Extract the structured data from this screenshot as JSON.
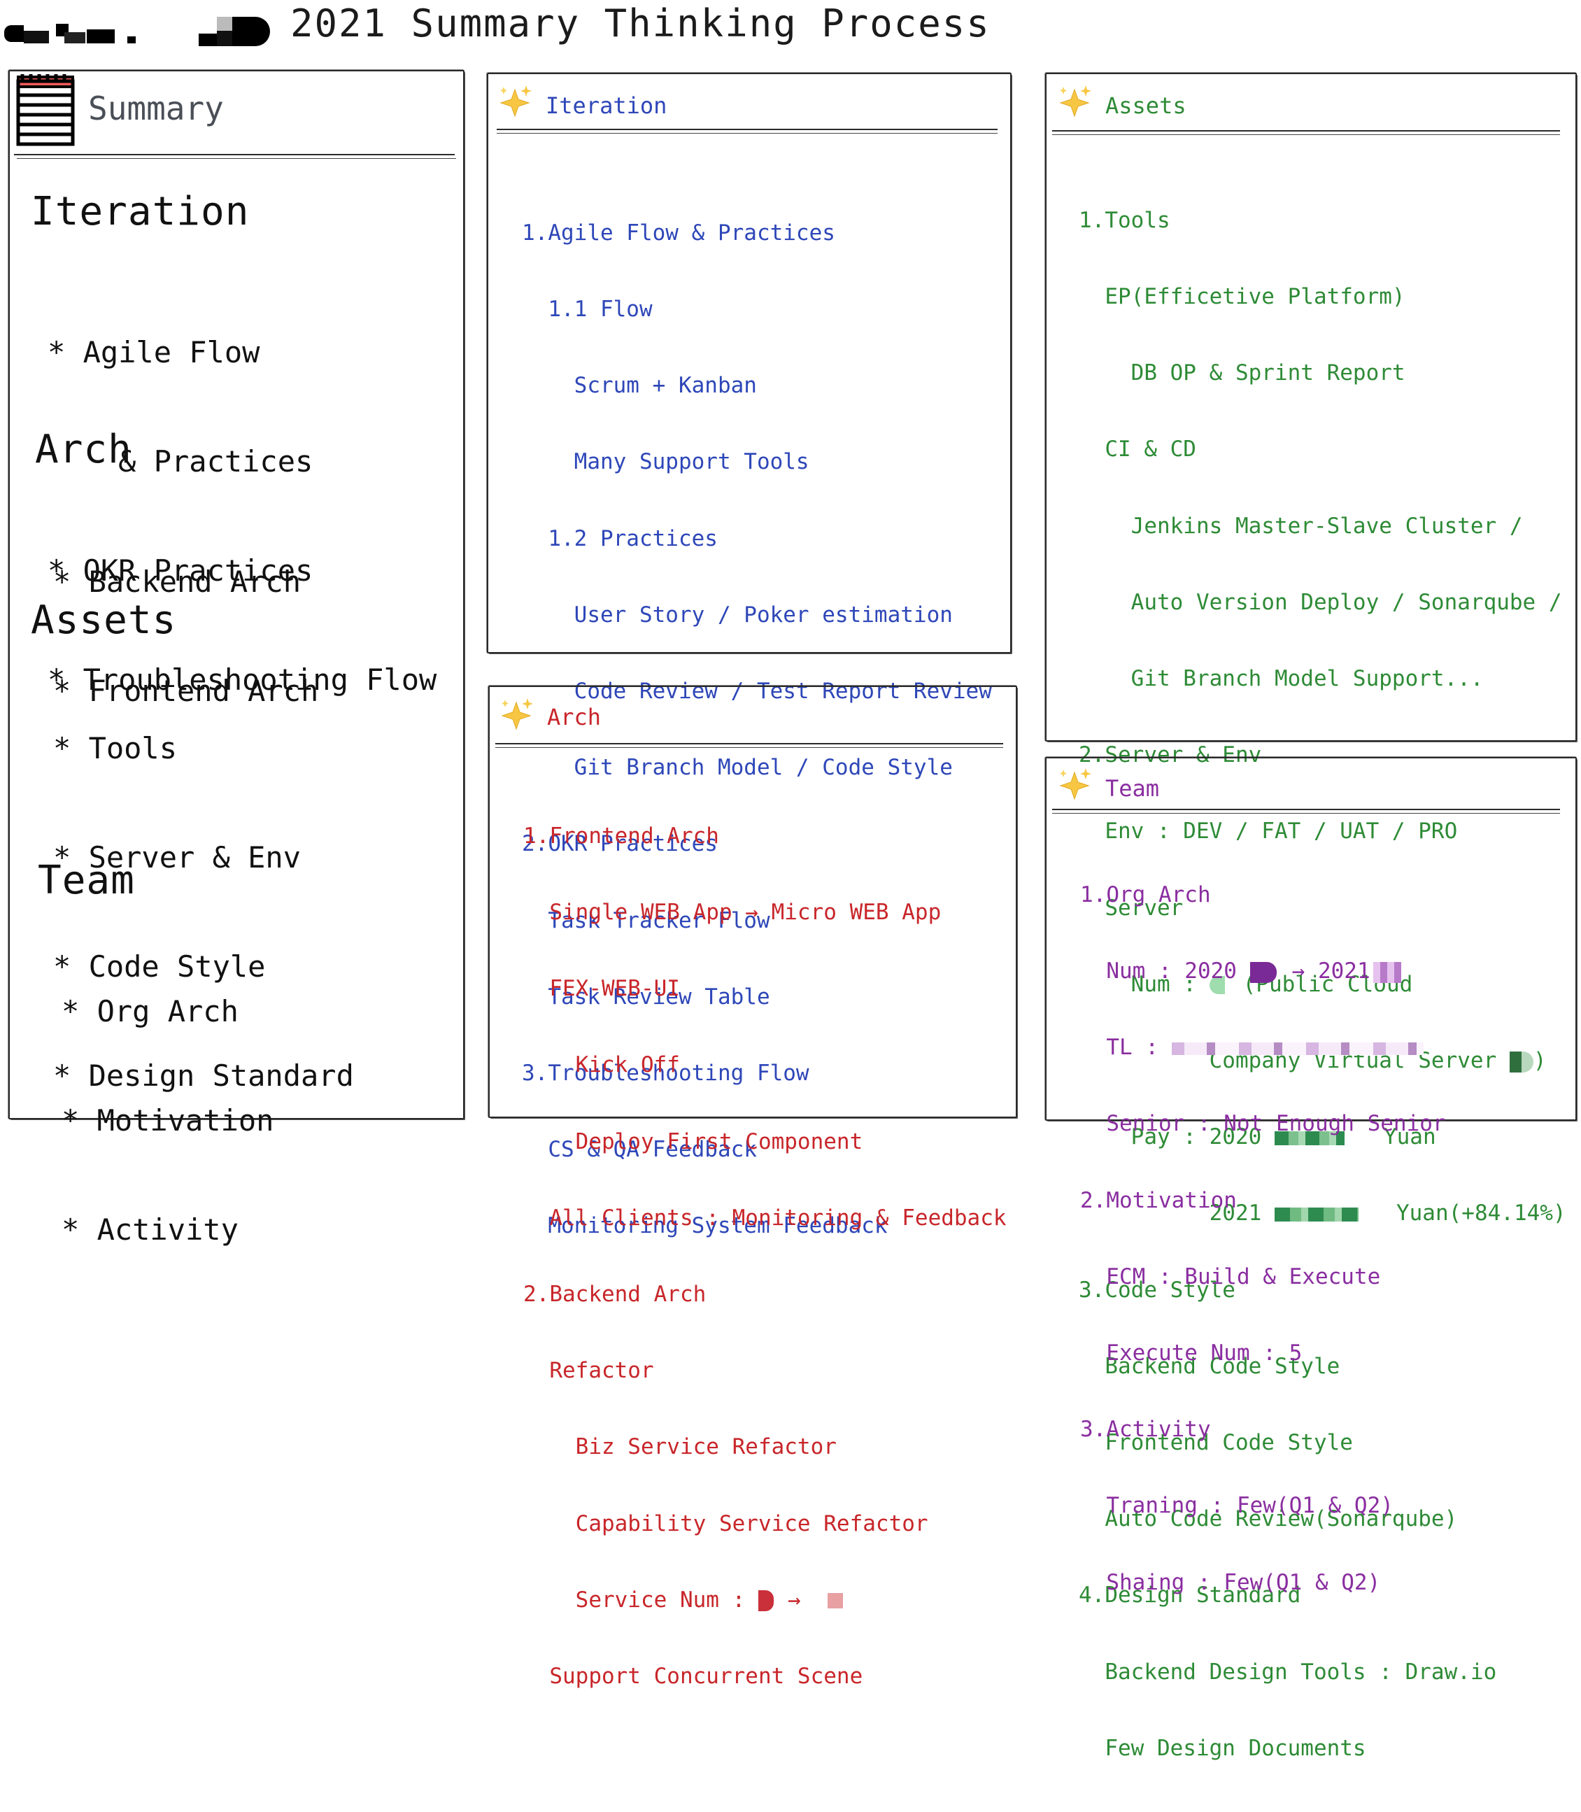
{
  "title": "2021 Summary Thinking Process",
  "summary": {
    "header": "Summary",
    "icon": "notepad-icon",
    "sections": [
      {
        "heading": "Iteration",
        "items": [
          "* Agile Flow",
          "    & Practices",
          "* OKR Practices",
          "* Troubleshooting Flow"
        ]
      },
      {
        "heading": "Arch",
        "items": [
          "* Backend Arch",
          "* Frontend Arch"
        ]
      },
      {
        "heading": "Assets",
        "items": [
          "* Tools",
          "* Server & Env",
          "* Code Style",
          "* Design Standard"
        ]
      },
      {
        "heading": "Team",
        "items": [
          "* Org Arch",
          "* Motivation",
          "* Activity"
        ]
      }
    ]
  },
  "cards": {
    "iteration": {
      "title": "Iteration",
      "icon": "sparkles-icon",
      "color": "#2e47b8",
      "lines": [
        "1.Agile Flow & Practices",
        "  1.1 Flow",
        "    Scrum + Kanban",
        "    Many Support Tools",
        "  1.2 Practices",
        "    User Story / Poker estimation",
        "    Code Review / Test Report Review",
        "    Git Branch Model / Code Style",
        "2.OKR Practices",
        "  Task Tracker Flow",
        "  Task Review Table",
        "3.Troubleshooting Flow",
        "  CS & QA Feedback",
        "  Monitoring System Feedback"
      ]
    },
    "arch": {
      "title": "Arch",
      "icon": "sparkles-icon",
      "color": "#c8262a",
      "lines": [
        "1.Frontend Arch",
        "  Single WEB App → Micro WEB App",
        "  FEX-WEB-UI",
        "    Kick Off",
        "    Deploy First Component",
        "  All Clients : Monitoring & Feedback",
        "2.Backend Arch",
        "  Refactor",
        "    Biz Service Refactor",
        "    Capability Service Refactor",
        "    Service Num : ",
        "  Support Concurrent Scene"
      ],
      "service_arrow": "→"
    },
    "assets": {
      "title": "Assets",
      "icon": "sparkles-icon",
      "color": "#2e8b36",
      "lines": [
        "1.Tools",
        "  EP(Efficetive Platform)",
        "    DB OP & Sprint Report",
        "  CI & CD",
        "    Jenkins Master-Slave Cluster /",
        "    Auto Version Deploy / Sonarqube /",
        "    Git Branch Model Support...",
        "2.Server & Env",
        "  Env : DEV / FAT / UAT / PRO",
        "  Server",
        "    Num : ",
        "          Company Virtual Server ",
        "    Pay : 2020 ",
        "          2021 ",
        "3.Code Style",
        "  Backend Code Style",
        "  Frontend Code Style",
        "  Auto Code Review(Sonarqube)",
        "4.Design Standard",
        "  Backend Design Tools : Draw.io",
        "  Few Design Documents"
      ],
      "num_suffix": "(Public Cloud",
      "virtual_suffix": ")",
      "pay_2020_suffix": "Yuan",
      "pay_2021_suffix": "Yuan(+84.14%)"
    },
    "team": {
      "title": "Team",
      "icon": "sparkles-icon",
      "color": "#8a2ea0",
      "lines": [
        "1.Org Arch",
        "  Num : 2020 ",
        "  TL : ",
        "  Senior : Not Enough Senior",
        "2.Motivation",
        "  ECM : Build & Execute",
        "  Execute Num : 5",
        "3.Activity",
        "  Traning : Few(Q1 & Q2)",
        "  Shaing : Few(Q1 & Q2)"
      ],
      "num_arrow": "→ 2021"
    }
  }
}
